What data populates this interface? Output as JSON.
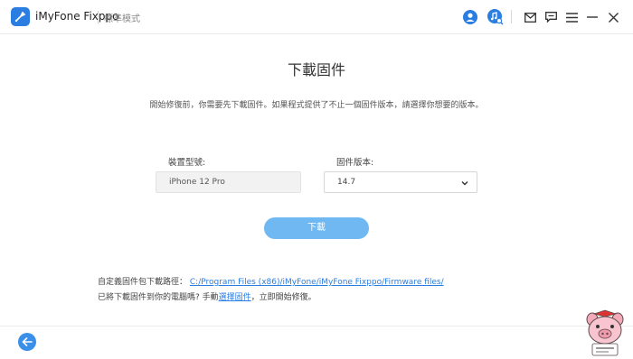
{
  "app": {
    "name": "iMyFone Fixppo",
    "mode": "標準模式"
  },
  "titlebar_icons": [
    "account-icon",
    "music-search-icon",
    "mail-icon",
    "feedback-icon",
    "menu-icon",
    "minimize-icon",
    "close-icon"
  ],
  "main": {
    "heading": "下載固件",
    "description": "開始修復前，你需要先下載固件。如果程式提供了不止一個固件版本，請選擇你想要的版本。",
    "model_label": "裝置型號:",
    "model_value": "iPhone 12 Pro",
    "version_label": "固件版本:",
    "version_value": "14.7",
    "download_button": "下載"
  },
  "footer": {
    "path_prefix": "自定義固件包下載路徑：",
    "path_link": "C:/Program Files (x86)/iMyFone/iMyFone Fixppo/Firmware files/",
    "manual_prefix": "已將下載固件到你的電腦嗎? 手動",
    "manual_link": "選擇固件",
    "manual_suffix": "，立即開始修復。"
  },
  "colors": {
    "accent": "#2a7de1",
    "button": "#6fb8f2"
  }
}
